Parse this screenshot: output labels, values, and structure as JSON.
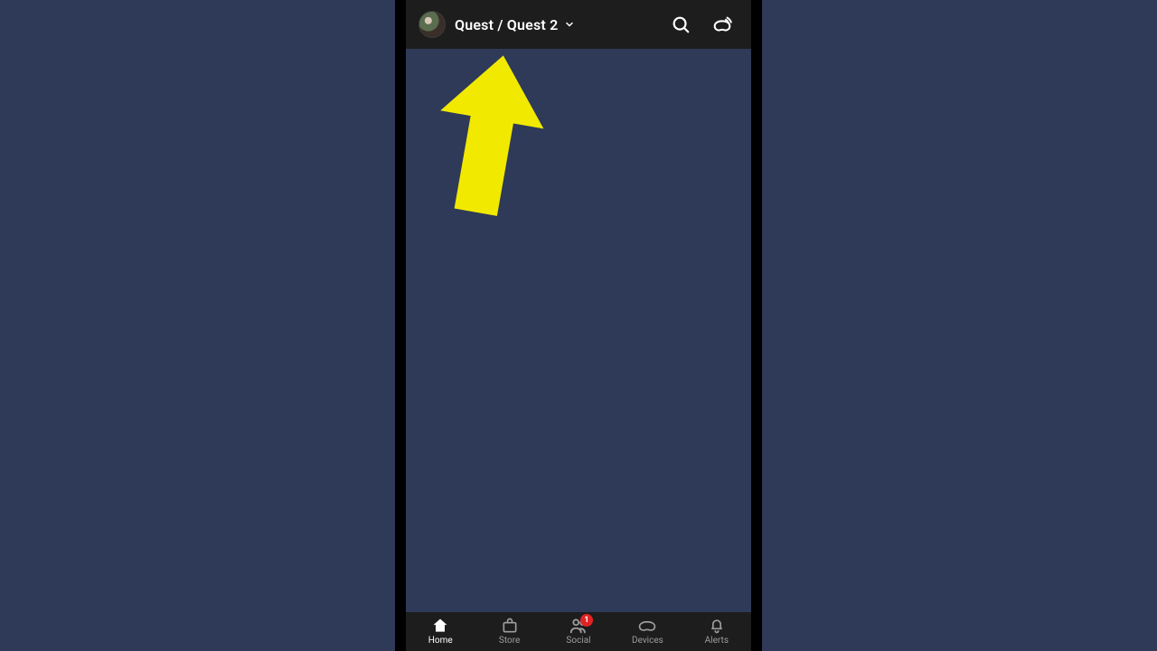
{
  "header": {
    "device_label": "Quest / Quest 2"
  },
  "nav": {
    "items": [
      {
        "label": "Home",
        "active": true
      },
      {
        "label": "Store",
        "active": false
      },
      {
        "label": "Social",
        "active": false,
        "badge": "1"
      },
      {
        "label": "Devices",
        "active": false
      },
      {
        "label": "Alerts",
        "active": false
      }
    ]
  },
  "colors": {
    "page_bg": "#2e3a57",
    "chrome_bg": "#1d1d1d",
    "arrow": "#f2e900",
    "badge": "#e02323"
  }
}
